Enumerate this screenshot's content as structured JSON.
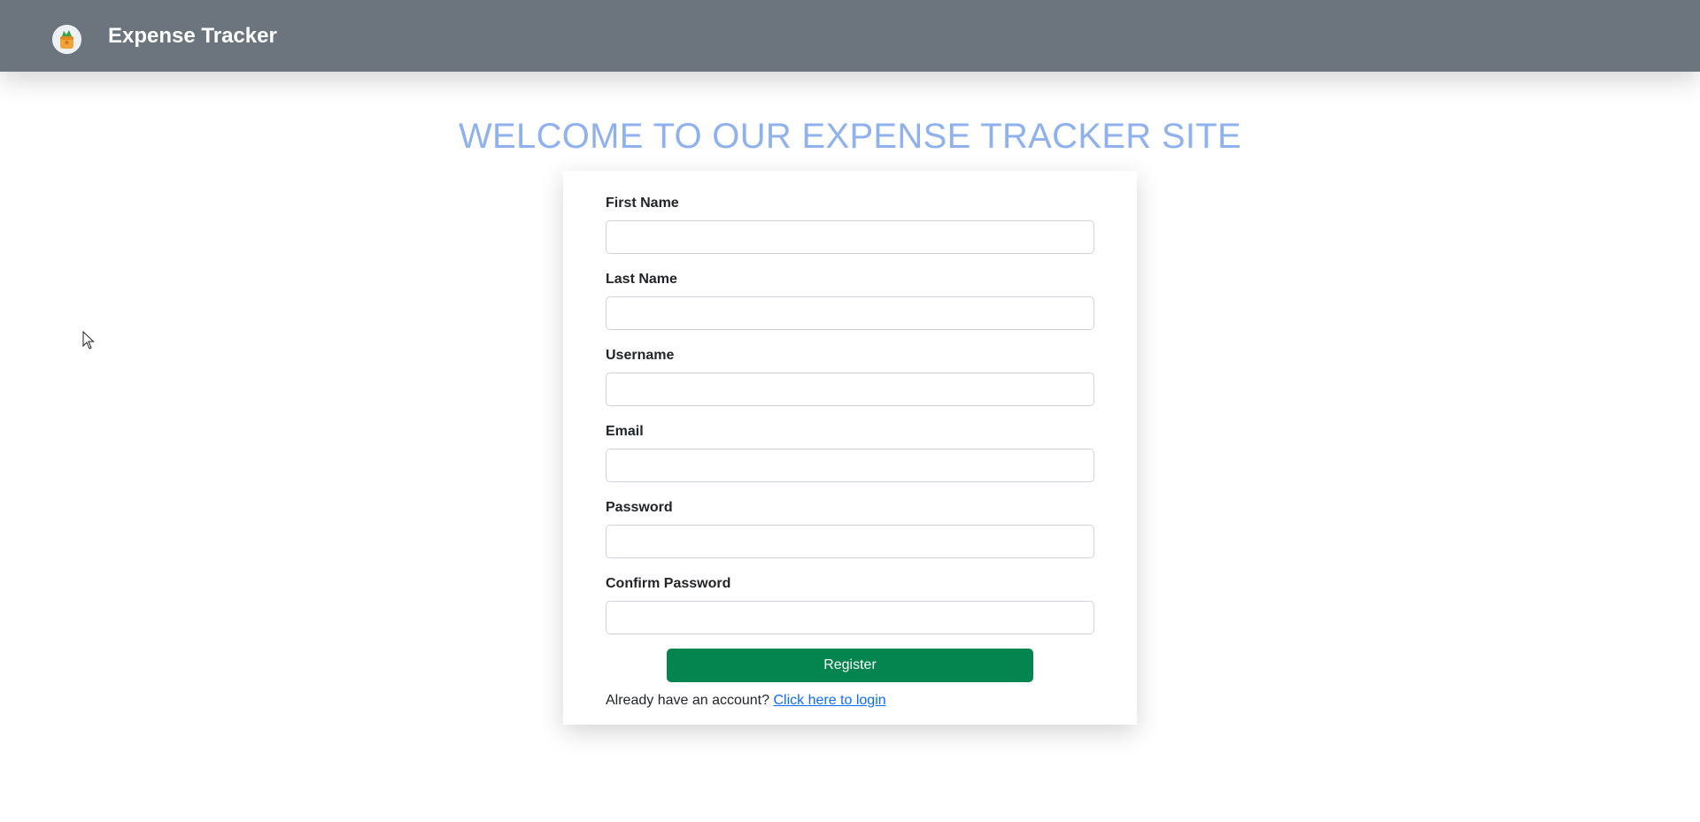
{
  "navbar": {
    "brand_title": "Expense Tracker",
    "logo_icon": "wallet-money-icon"
  },
  "welcome_heading": "WELCOME TO OUR EXPENSE TRACKER SITE",
  "form": {
    "fields": [
      {
        "label": "First Name",
        "value": "",
        "placeholder": ""
      },
      {
        "label": "Last Name",
        "value": "",
        "placeholder": ""
      },
      {
        "label": "Username",
        "value": "",
        "placeholder": ""
      },
      {
        "label": "Email",
        "value": "",
        "placeholder": ""
      },
      {
        "label": "Password",
        "value": "",
        "placeholder": ""
      },
      {
        "label": "Confirm Password",
        "value": "",
        "placeholder": ""
      }
    ],
    "register_label": "Register",
    "login_prompt": "Already have an account?",
    "login_link": "Click here to login"
  },
  "colors": {
    "navbar": "#6c757d",
    "heading": "#8fb1ee",
    "register_button": "#04854f",
    "link": "#0d6efd"
  }
}
